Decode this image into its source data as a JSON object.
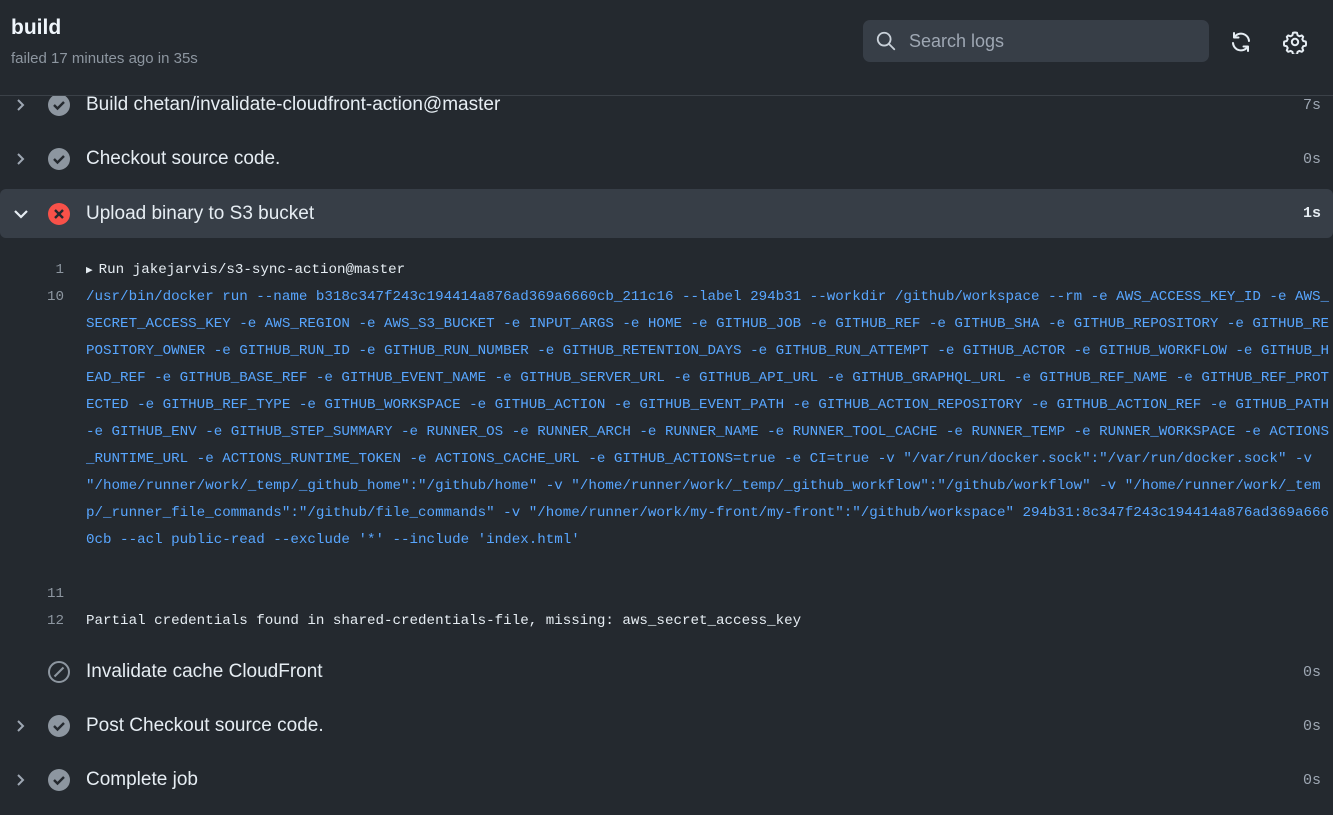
{
  "header": {
    "title": "build",
    "status": "failed 17 minutes ago in 35s",
    "search_placeholder": "Search logs"
  },
  "steps": [
    {
      "label": "Build chetan/invalidate-cloudfront-action@master",
      "duration": "7s",
      "status": "success"
    },
    {
      "label": "Checkout source code.",
      "duration": "0s",
      "status": "success"
    },
    {
      "label": "Upload binary to S3 bucket",
      "duration": "1s",
      "status": "failure"
    },
    {
      "label": "Invalidate cache CloudFront",
      "duration": "0s",
      "status": "skipped"
    },
    {
      "label": "Post Checkout source code.",
      "duration": "0s",
      "status": "success"
    },
    {
      "label": "Complete job",
      "duration": "0s",
      "status": "success"
    }
  ],
  "log": {
    "lines": [
      {
        "num": "1",
        "text": "Run jakejarvis/s3-sync-action@master",
        "kind": "group"
      },
      {
        "num": "10",
        "text": "/usr/bin/docker run --name b318c347f243c194414a876ad369a6660cb_211c16 --label 294b31 --workdir /github/workspace --rm -e AWS_ACCESS_KEY_ID -e AWS_SECRET_ACCESS_KEY -e AWS_REGION -e AWS_S3_BUCKET -e INPUT_ARGS -e HOME -e GITHUB_JOB -e GITHUB_REF -e GITHUB_SHA -e GITHUB_REPOSITORY -e GITHUB_REPOSITORY_OWNER -e GITHUB_RUN_ID -e GITHUB_RUN_NUMBER -e GITHUB_RETENTION_DAYS -e GITHUB_RUN_ATTEMPT -e GITHUB_ACTOR -e GITHUB_WORKFLOW -e GITHUB_HEAD_REF -e GITHUB_BASE_REF -e GITHUB_EVENT_NAME -e GITHUB_SERVER_URL -e GITHUB_API_URL -e GITHUB_GRAPHQL_URL -e GITHUB_REF_NAME -e GITHUB_REF_PROTECTED -e GITHUB_REF_TYPE -e GITHUB_WORKSPACE -e GITHUB_ACTION -e GITHUB_EVENT_PATH -e GITHUB_ACTION_REPOSITORY -e GITHUB_ACTION_REF -e GITHUB_PATH -e GITHUB_ENV -e GITHUB_STEP_SUMMARY -e RUNNER_OS -e RUNNER_ARCH -e RUNNER_NAME -e RUNNER_TOOL_CACHE -e RUNNER_TEMP -e RUNNER_WORKSPACE -e ACTIONS_RUNTIME_URL -e ACTIONS_RUNTIME_TOKEN -e ACTIONS_CACHE_URL -e GITHUB_ACTIONS=true -e CI=true -v \"/var/run/docker.sock\":\"/var/run/docker.sock\" -v \"/home/runner/work/_temp/_github_home\":\"/github/home\" -v \"/home/runner/work/_temp/_github_workflow\":\"/github/workflow\" -v \"/home/runner/work/_temp/_runner_file_commands\":\"/github/file_commands\" -v \"/home/runner/work/my-front/my-front\":\"/github/workspace\" 294b31:8c347f243c194414a876ad369a6660cb --acl public-read --exclude '*' --include 'index.html'",
        "kind": "command"
      },
      {
        "num": "11",
        "text": "",
        "kind": "plain"
      },
      {
        "num": "12",
        "text": "Partial credentials found in shared-credentials-file, missing: aws_secret_access_key",
        "kind": "plain"
      }
    ]
  },
  "colors": {
    "success": "#8d96a0",
    "failure": "#f85149",
    "command": "#58a6ff"
  }
}
